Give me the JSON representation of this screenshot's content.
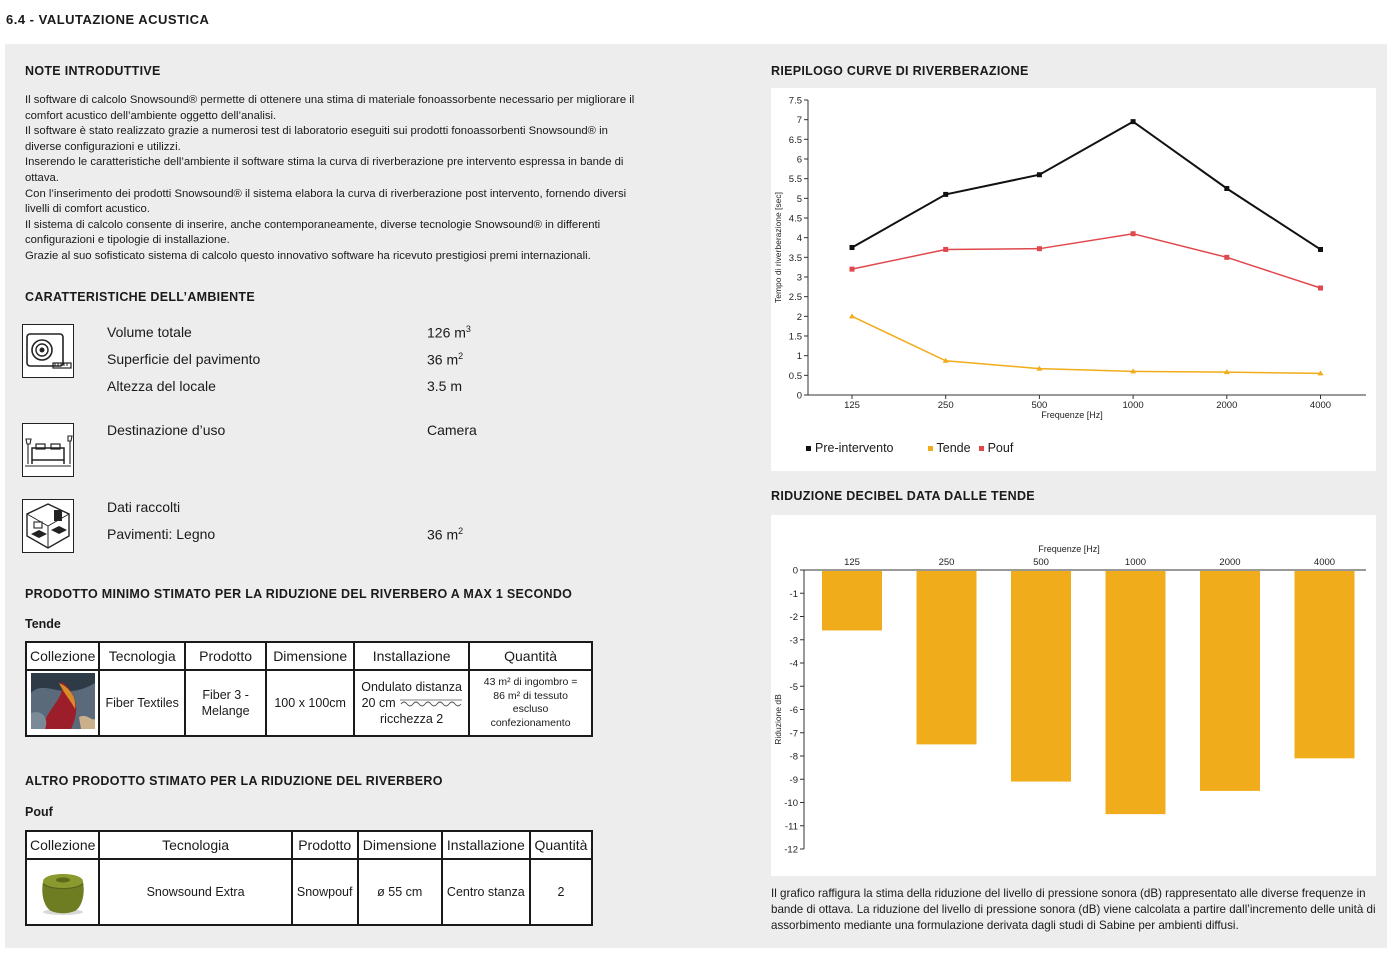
{
  "page_title": "6.4 - VALUTAZIONE ACUSTICA",
  "intro": {
    "heading": "NOTE INTRODUTTIVE",
    "paragraphs": [
      "Il software di calcolo Snowsound® permette di ottenere una stima di materiale fonoassorbente necessario per migliorare il comfort acustico dell’ambiente oggetto dell’analisi.",
      "Il software è stato realizzato grazie a numerosi test di laboratorio eseguiti sui prodotti fonoassorbenti Snowsound® in diverse configurazioni e utilizzi.",
      "Inserendo le caratteristiche dell’ambiente il software stima la curva di riverberazione pre intervento espressa in bande di ottava.",
      "Con l’inserimento dei prodotti Snowsound® il sistema elabora la curva di riverberazione post intervento, fornendo diversi livelli di comfort acustico.",
      "Il sistema di calcolo consente di inserire, anche contemporaneamente, diverse tecnologie Snowsound® in differenti configurazioni e tipologie di installazione.",
      "Grazie al suo sofisticato sistema di calcolo questo innovativo software ha ricevuto prestigiosi premi internazionali."
    ]
  },
  "ambiente": {
    "heading": "CARATTERISTICHE DELL’AMBIENTE",
    "volume_label": "Volume totale",
    "volume_value": "126 m",
    "volume_exp": "3",
    "superficie_label": "Superficie del pavimento",
    "superficie_value": "36 m",
    "superficie_exp": "2",
    "altezza_label": "Altezza del locale",
    "altezza_value": "3.5 m",
    "destinazione_label": "Destinazione d’uso",
    "destinazione_value": "Camera",
    "dati_label": "Dati raccolti",
    "pavimenti_label": "Pavimenti: Legno",
    "pavimenti_value": "36 m",
    "pavimenti_exp": "2",
    "icons": [
      "tape-measure-icon",
      "bedroom-icon",
      "room-floor-icon"
    ]
  },
  "prodotto_minimo": {
    "heading": "PRODOTTO MINIMO STIMATO PER LA RIDUZIONE DEL RIVERBERO A MAX 1 SECONDO",
    "subheading": "Tende",
    "headers": [
      "Collezione",
      "Tecnologia",
      "Prodotto",
      "Dimensione",
      "Installazione",
      "Quantità"
    ],
    "row": {
      "tecnologia": "Fiber Textiles",
      "prodotto_1": "Fiber 3 -",
      "prodotto_2": "Melange",
      "dimensione": "100 x 100cm",
      "inst_1": "Ondulato distanza",
      "inst_2": "20 cm",
      "inst_3": "ricchezza 2",
      "qty_1": "43  m² di ingombro =",
      "qty_2": "86  m² di tessuto",
      "qty_3": "escluso",
      "qty_4": "confezionamento"
    }
  },
  "altro_prodotto": {
    "heading": "ALTRO PRODOTTO STIMATO PER LA RIDUZIONE DEL RIVERBERO",
    "subheading": "Pouf",
    "headers": [
      "Collezione",
      "Tecnologia",
      "Prodotto",
      "Dimensione",
      "Installazione",
      "Quantità"
    ],
    "row": {
      "tecnologia": "Snowsound Extra",
      "prodotto": "Snowpouf",
      "dimensione": "ø 55 cm",
      "installazione": "Centro stanza",
      "quantita": "2"
    }
  },
  "caption": "Il grafico raffigura la stima della riduzione del livello di pressione sonora (dB) rappresentato alle diverse frequenze in bande di ottava. La riduzione del livello di pressione sonora (dB) viene calcolata a partire dall’incremento delle unità di assorbimento mediante una formulazione derivata dagli studi di Sabine per ambienti diffusi.",
  "chart_data": [
    {
      "type": "line",
      "title": "RIEPILOGO CURVE DI RIVERBERAZIONE",
      "xlabel": "Frequenze [Hz]",
      "ylabel": "Tempo di riverberazione [sec]",
      "categories": [
        "125",
        "250",
        "500",
        "1000",
        "2000",
        "4000"
      ],
      "yticks": [
        "0",
        "0.5",
        "1",
        "1.5",
        "2",
        "2.5",
        "3",
        "3.5",
        "4",
        "4.5",
        "5",
        "5.5",
        "6",
        "6.5",
        "7",
        "7.5"
      ],
      "ylim": [
        0,
        7.5
      ],
      "grid": false,
      "legend": "bottom",
      "series": [
        {
          "name": "Pre-intervento",
          "color": "#111111",
          "values": [
            3.75,
            5.1,
            5.6,
            6.95,
            5.25,
            3.7
          ]
        },
        {
          "name": "Tende",
          "color": "#f0ac1a",
          "values": [
            2.0,
            0.87,
            0.67,
            0.6,
            0.58,
            0.55
          ]
        },
        {
          "name": "Pouf",
          "color": "#e0484c",
          "values": [
            3.2,
            3.7,
            3.72,
            4.1,
            3.5,
            2.72
          ]
        }
      ]
    },
    {
      "type": "bar",
      "title": "RIDUZIONE DECIBEL DATA DALLE TENDE",
      "xlabel": "Frequenze [Hz]",
      "ylabel": "Riduzione dB",
      "categories": [
        "125",
        "250",
        "500",
        "1000",
        "2000",
        "4000"
      ],
      "yticks": [
        "0",
        "-1",
        "-2",
        "-3",
        "-4",
        "-5",
        "-6",
        "-7",
        "-8",
        "-9",
        "-10",
        "-11",
        "-12"
      ],
      "ylim": [
        -12,
        0
      ],
      "grid": false,
      "color": "#f0ac1a",
      "values": [
        -2.6,
        -7.5,
        -9.1,
        -10.5,
        -9.5,
        -8.1
      ]
    }
  ]
}
